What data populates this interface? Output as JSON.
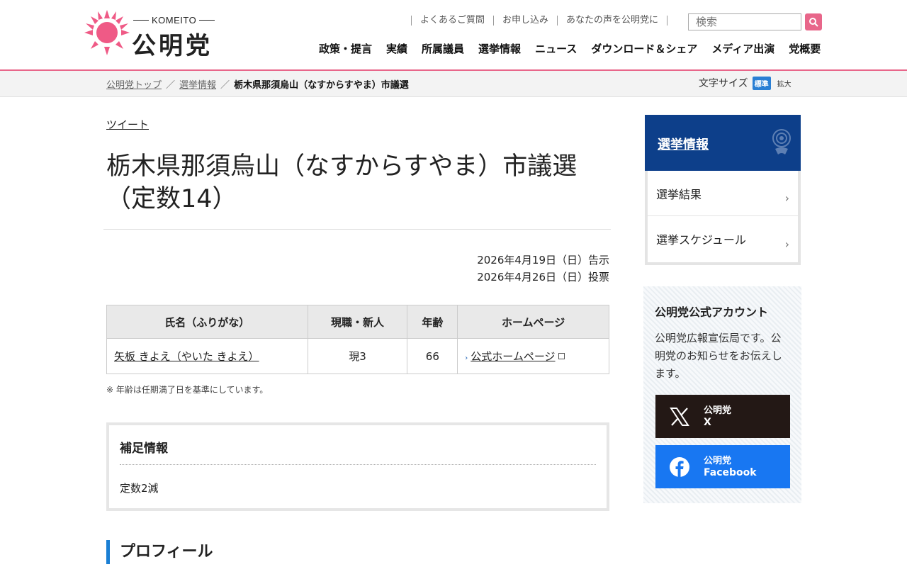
{
  "header": {
    "logo_sub": "KOMEITO",
    "logo_main": "公明党",
    "util_links": [
      "よくあるご質問",
      "お申し込み",
      "あなたの声を公明党に"
    ],
    "search_placeholder": "検索",
    "nav": [
      "政策・提言",
      "実績",
      "所属議員",
      "選挙情報",
      "ニュース",
      "ダウンロード＆シェア",
      "メディア出演",
      "党概要"
    ]
  },
  "breadcrumb": {
    "items": [
      "公明党トップ",
      "選挙情報"
    ],
    "current": "栃木県那須烏山（なすからすやま）市議選",
    "sep": "／"
  },
  "font_size": {
    "label": "文字サイズ",
    "standard": "標準",
    "large": "拡大"
  },
  "main": {
    "tweet": "ツイート",
    "title": "栃木県那須烏山（なすからすやま）市議選（定数14）",
    "dates": [
      "2026年4月19日（日）告示",
      "2026年4月26日（日）投票"
    ],
    "table": {
      "headers": [
        "氏名（ふりがな）",
        "現職・新人",
        "年齢",
        "ホームページ"
      ],
      "rows": [
        {
          "name": "矢板 きよえ（やいた きよえ）",
          "status": "現3",
          "age": "66",
          "homepage": "公式ホームページ"
        }
      ]
    },
    "note": "※ 年齢は任期満了日を基準にしています。",
    "supplement": {
      "heading": "補足情報",
      "text": "定数2減"
    },
    "profile_heading": "プロフィール"
  },
  "side": {
    "heading": "選挙情報",
    "items": [
      "選挙結果",
      "選挙スケジュール"
    ],
    "account": {
      "heading": "公明党公式アカウント",
      "text": "公明党広報宣伝局です。公明党のお知らせをお伝えします。",
      "x": {
        "line1": "公明党",
        "line2": "X"
      },
      "facebook": {
        "line1": "公明党",
        "line2": "Facebook"
      }
    }
  },
  "colors": {
    "brand_pink": "#e8668a",
    "side_navy": "#0d3f8a",
    "x_black": "#231815",
    "facebook_blue": "#1877f2",
    "accent_blue": "#1a7fd4"
  }
}
